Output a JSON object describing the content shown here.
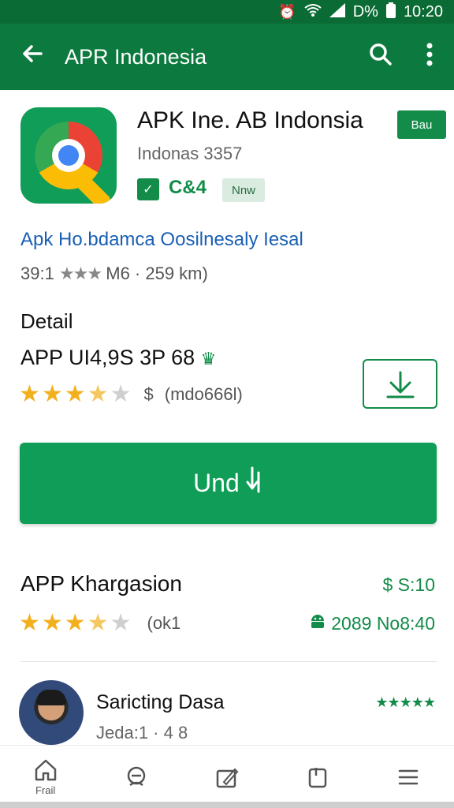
{
  "status_bar": {
    "battery": "D%",
    "time": "10:20"
  },
  "appbar": {
    "title": "APR Indonesia"
  },
  "app": {
    "title": "APK Ine. AB Indonsia",
    "badge": "Bau",
    "developer": "Indonas 3357",
    "category": "C&4",
    "tag": "Nnw"
  },
  "link_text": "Apk Ho.bdamca Oosilnesaly Iesal",
  "stats": {
    "rating": "39:1",
    "size": "M6 · 259 km)"
  },
  "detail": {
    "heading": "Detail",
    "value": "APP UI4,9S 3P 68",
    "price_symbol": "$",
    "count": "(mdo666l)",
    "rating_value": 3.5
  },
  "install_button": {
    "label": "Und"
  },
  "section2": {
    "title": "APP Khargasion",
    "price": "$ S:10",
    "count": "(ok1",
    "meta": "2089 No8:40",
    "rating_value": 3.5
  },
  "review": {
    "name": "Saricting Dasa",
    "sub": "Jeda:1 · 4 8",
    "stars": "★★★★★"
  },
  "bottom_nav": {
    "home_label": "Frail"
  }
}
